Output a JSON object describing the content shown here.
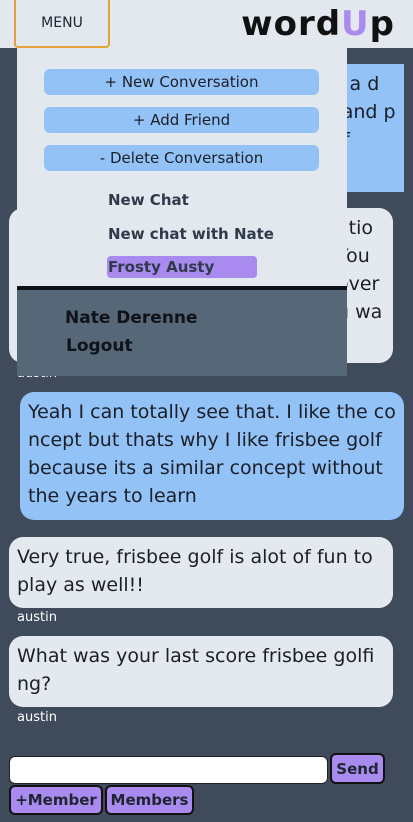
{
  "header": {
    "menu_label": "MENU",
    "logo_pre": "word",
    "logo_accent": "U",
    "logo_post": "p"
  },
  "menu": {
    "actions": [
      {
        "label": "+ New Conversation"
      },
      {
        "label": "+ Add Friend"
      },
      {
        "label": "- Delete Conversation"
      }
    ],
    "conversations": [
      {
        "label": "New Chat",
        "active": false
      },
      {
        "label": "New chat with Nate",
        "active": false
      },
      {
        "label": "Frosty Austy",
        "active": true
      }
    ],
    "user_name": "Nate Derenne",
    "logout_label": "Logout"
  },
  "messages": [
    {
      "sender": "",
      "own": true,
      "text": "ut a d e and pref"
    },
    {
      "sender": "austin",
      "own": false,
      "text": "atio You over u wa"
    },
    {
      "sender": "",
      "own": true,
      "text": "Yeah I can totally see that. I like the concept but thats why I like frisbee golf because its a similar concept without the years to learn"
    },
    {
      "sender": "austin",
      "own": false,
      "text": "Very true, frisbee golf is alot of fun to play as well!!"
    },
    {
      "sender": "austin",
      "own": false,
      "text": "What was your last score frisbee golfing?"
    }
  ],
  "composer": {
    "value": "",
    "placeholder": "",
    "send_label": "Send",
    "add_member_label": "+Member",
    "members_label": "Members"
  },
  "colors": {
    "accent": "#a98bf0",
    "own_bubble": "#93c2f7",
    "other_bubble": "#e4e8ef",
    "background": "#3f4a5a",
    "menu_border": "#e3a23a"
  }
}
